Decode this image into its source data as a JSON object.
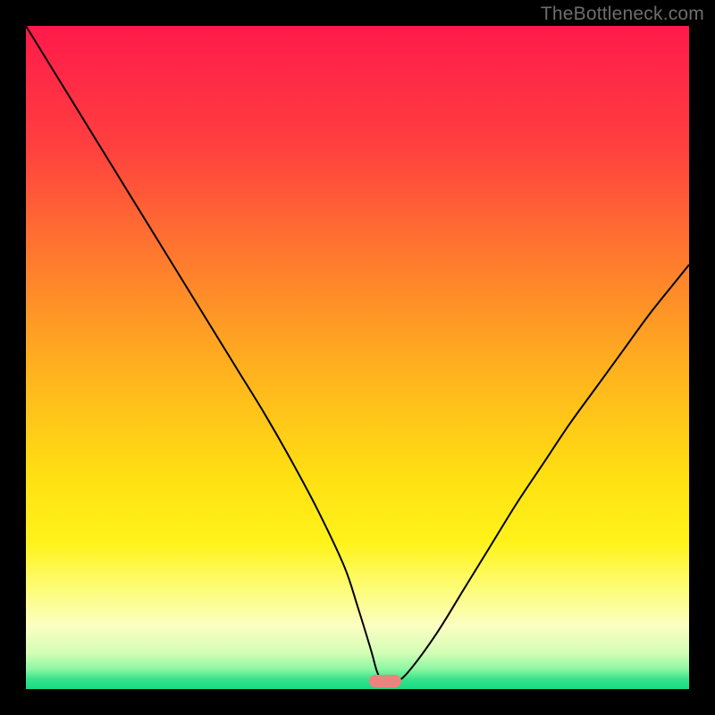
{
  "watermark": {
    "text": "TheBottleneck.com"
  },
  "chart_data": {
    "type": "line",
    "title": "",
    "xlabel": "",
    "ylabel": "",
    "xlim": [
      0,
      100
    ],
    "ylim": [
      0,
      100
    ],
    "grid": false,
    "legend": false,
    "background": {
      "type": "vertical-gradient",
      "stops": [
        {
          "offset": 0.0,
          "color": "#ff1a4b"
        },
        {
          "offset": 0.18,
          "color": "#ff3f3f"
        },
        {
          "offset": 0.35,
          "color": "#ff7a2e"
        },
        {
          "offset": 0.52,
          "color": "#ffb21e"
        },
        {
          "offset": 0.68,
          "color": "#ffe012"
        },
        {
          "offset": 0.78,
          "color": "#fff31a"
        },
        {
          "offset": 0.85,
          "color": "#fdfd7a"
        },
        {
          "offset": 0.905,
          "color": "#fbfec2"
        },
        {
          "offset": 0.945,
          "color": "#d4feb5"
        },
        {
          "offset": 0.97,
          "color": "#8cf6a3"
        },
        {
          "offset": 0.985,
          "color": "#38e38b"
        },
        {
          "offset": 1.0,
          "color": "#17da84"
        }
      ]
    },
    "series": [
      {
        "name": "bottleneck-curve",
        "color": "#000000",
        "stroke_width": 2,
        "x": [
          0,
          4,
          8,
          12,
          16,
          20,
          24,
          28,
          32,
          36,
          40,
          44,
          48,
          50,
          52,
          53,
          54,
          56,
          58,
          62,
          66,
          70,
          74,
          78,
          82,
          86,
          90,
          94,
          98,
          100
        ],
        "y": [
          100,
          93.5,
          87,
          80.5,
          74,
          67.5,
          61,
          54.5,
          48,
          41.5,
          34.5,
          27,
          18.5,
          12.5,
          6,
          2.5,
          1.2,
          1.2,
          3,
          8.5,
          15,
          21.5,
          28,
          34,
          40,
          45.5,
          51,
          56.5,
          61.5,
          64
        ]
      }
    ],
    "marker": {
      "name": "optimal-point",
      "x": 54.2,
      "width": 4.8,
      "y": 1.2,
      "height": 1.8,
      "color": "#e9857e"
    },
    "annotations": []
  }
}
